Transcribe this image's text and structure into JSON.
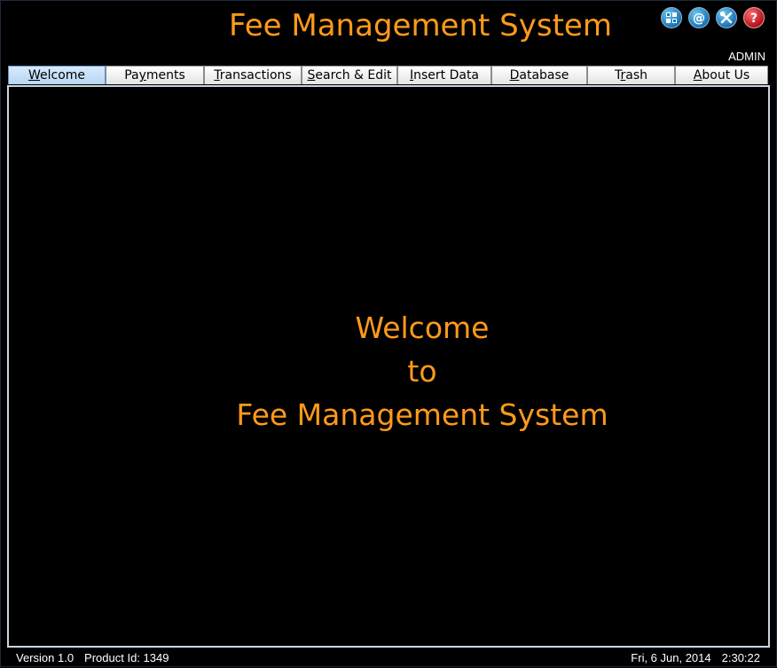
{
  "app": {
    "title": "Fee Management System",
    "user": "ADMIN"
  },
  "toolbar_icons": [
    {
      "name": "apps-grid-icon",
      "color": "#1a73b5"
    },
    {
      "name": "email-icon",
      "color": "#1a73b5"
    },
    {
      "name": "tools-icon",
      "color": "#1a73b5"
    },
    {
      "name": "help-icon",
      "color": "#b0121b"
    }
  ],
  "tabs": [
    {
      "label": "Welcome",
      "mnemonic_index": 0,
      "active": true
    },
    {
      "label": "Payments",
      "mnemonic_index": 2,
      "active": false
    },
    {
      "label": "Transactions",
      "mnemonic_index": 0,
      "active": false
    },
    {
      "label": "Search & Edit",
      "mnemonic_index": 0,
      "active": false
    },
    {
      "label": "Insert Data",
      "mnemonic_index": 0,
      "active": false
    },
    {
      "label": "Database",
      "mnemonic_index": 0,
      "active": false
    },
    {
      "label": "Trash",
      "mnemonic_index": 1,
      "active": false
    },
    {
      "label": "About Us",
      "mnemonic_index": 0,
      "active": false
    }
  ],
  "welcome": {
    "line1": "Welcome",
    "line2": "to",
    "line3": "Fee Management System"
  },
  "status": {
    "version": "Version 1.0",
    "product_id": "Product Id: 1349",
    "date": "Fri, 6 Jun, 2014",
    "time": "2:30:22"
  },
  "colors": {
    "accent": "#ff9a1a",
    "background": "#000000",
    "active_tab": "#b9d6f3"
  }
}
